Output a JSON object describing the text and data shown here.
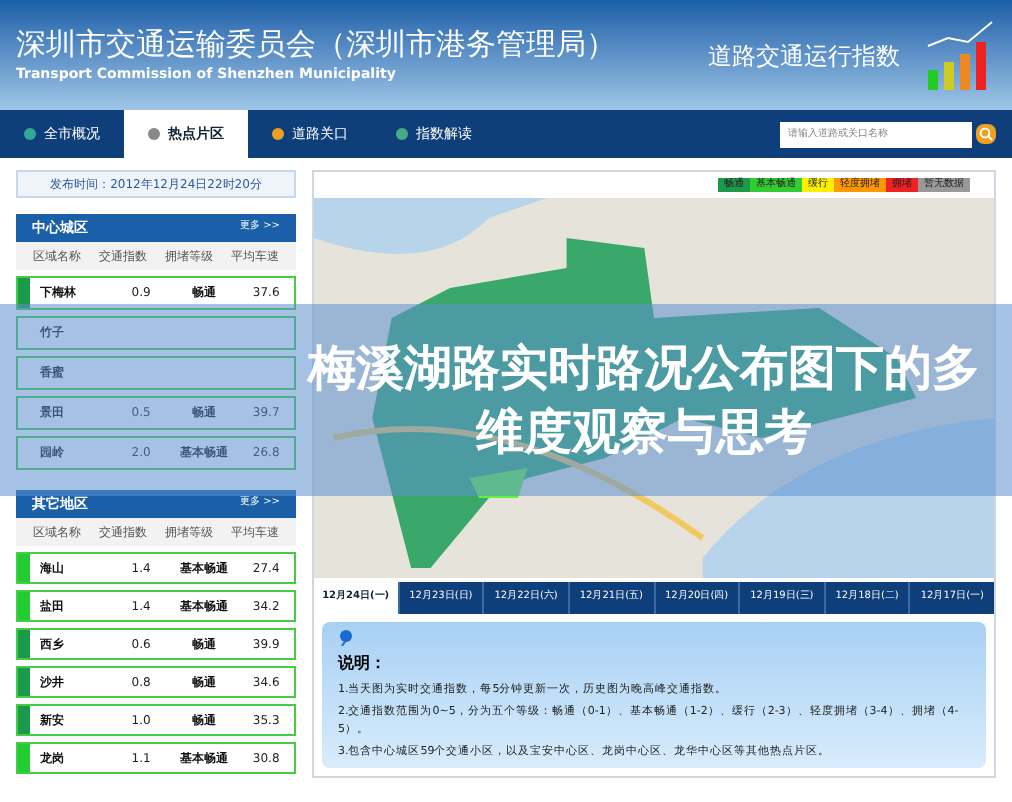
{
  "header": {
    "title": "深圳市交通运输委员会（深圳市港务管理局）",
    "subtitle": "Transport Commission of Shenzhen Municipality",
    "section_title": "道路交通运行指数"
  },
  "nav": {
    "tabs": [
      {
        "label": "全市概况",
        "selected": false
      },
      {
        "label": "热点片区",
        "selected": true
      },
      {
        "label": "道路关口",
        "selected": false
      },
      {
        "label": "指数解读",
        "selected": false
      }
    ],
    "search": {
      "placeholder": "请输入道路或关口名称"
    }
  },
  "publish_time": "发布时间：2012年12月24日22时20分",
  "panels": [
    {
      "title": "中心城区",
      "more": "更多 >>",
      "columns": [
        "区域名称",
        "交通指数",
        "拥堵等级",
        "平均车速"
      ],
      "rows": [
        {
          "name": "下梅林",
          "index": "0.9",
          "level": "畅通",
          "speed": "37.6",
          "color": "#1a9a4a"
        },
        {
          "name": "竹子"
        },
        {
          "name": "香蜜"
        },
        {
          "name": "景田",
          "index": "0.5",
          "level": "畅通",
          "speed": "39.7"
        },
        {
          "name": "园岭",
          "index": "2.0",
          "level": "基本畅通",
          "speed": "26.8"
        }
      ]
    },
    {
      "title": "其它地区",
      "more": "更多 >>",
      "columns": [
        "区域名称",
        "交通指数",
        "拥堵等级",
        "平均车速"
      ],
      "rows": [
        {
          "name": "海山",
          "index": "1.4",
          "level": "基本畅通",
          "speed": "27.4",
          "color": "#22cc33"
        },
        {
          "name": "盐田",
          "index": "1.4",
          "level": "基本畅通",
          "speed": "34.2",
          "color": "#22cc33"
        },
        {
          "name": "西乡",
          "index": "0.6",
          "level": "畅通",
          "speed": "39.9",
          "color": "#1a9a4a"
        },
        {
          "name": "沙井",
          "index": "0.8",
          "level": "畅通",
          "speed": "34.6",
          "color": "#1a9a4a"
        },
        {
          "name": "新安",
          "index": "1.0",
          "level": "畅通",
          "speed": "35.3",
          "color": "#1a9a4a"
        },
        {
          "name": "龙岗",
          "index": "1.1",
          "level": "基本畅通",
          "speed": "30.8",
          "color": "#22cc33"
        }
      ]
    }
  ],
  "legend": [
    {
      "label": "畅通",
      "color": "#1a9a4a"
    },
    {
      "label": "基本畅通",
      "color": "#33cc33"
    },
    {
      "label": "缓行",
      "color": "#ffee00"
    },
    {
      "label": "轻度拥堵",
      "color": "#ff9900"
    },
    {
      "label": "拥堵",
      "color": "#ee2222"
    },
    {
      "label": "暂无数据",
      "color": "#999999"
    }
  ],
  "date_tabs": [
    {
      "label": "12月24日(一)",
      "selected": true
    },
    {
      "label": "12月23日(日)",
      "selected": false
    },
    {
      "label": "12月22日(六)",
      "selected": false
    },
    {
      "label": "12月21日(五)",
      "selected": false
    },
    {
      "label": "12月20日(四)",
      "selected": false
    },
    {
      "label": "12月19日(三)",
      "selected": false
    },
    {
      "label": "12月18日(二)",
      "selected": false
    },
    {
      "label": "12月17日(一)",
      "selected": false
    }
  ],
  "notes": {
    "title": "说明：",
    "lines": [
      "1.当天图为实时交通指数，每5分钟更新一次，历史图为晚高峰交通指数。",
      "2.交通指数范围为0~5，分为五个等级：畅通（0-1）、基本畅通（1-2）、缓行（2-3）、轻度拥堵（3-4）、拥堵（4-5）。",
      "3.包含中心城区59个交通小区，以及宝安中心区、龙岗中心区、龙华中心区等其他热点片区。"
    ]
  },
  "banner": {
    "title": "梅溪湖路实时路况公布图下的多维度观察与思考"
  }
}
